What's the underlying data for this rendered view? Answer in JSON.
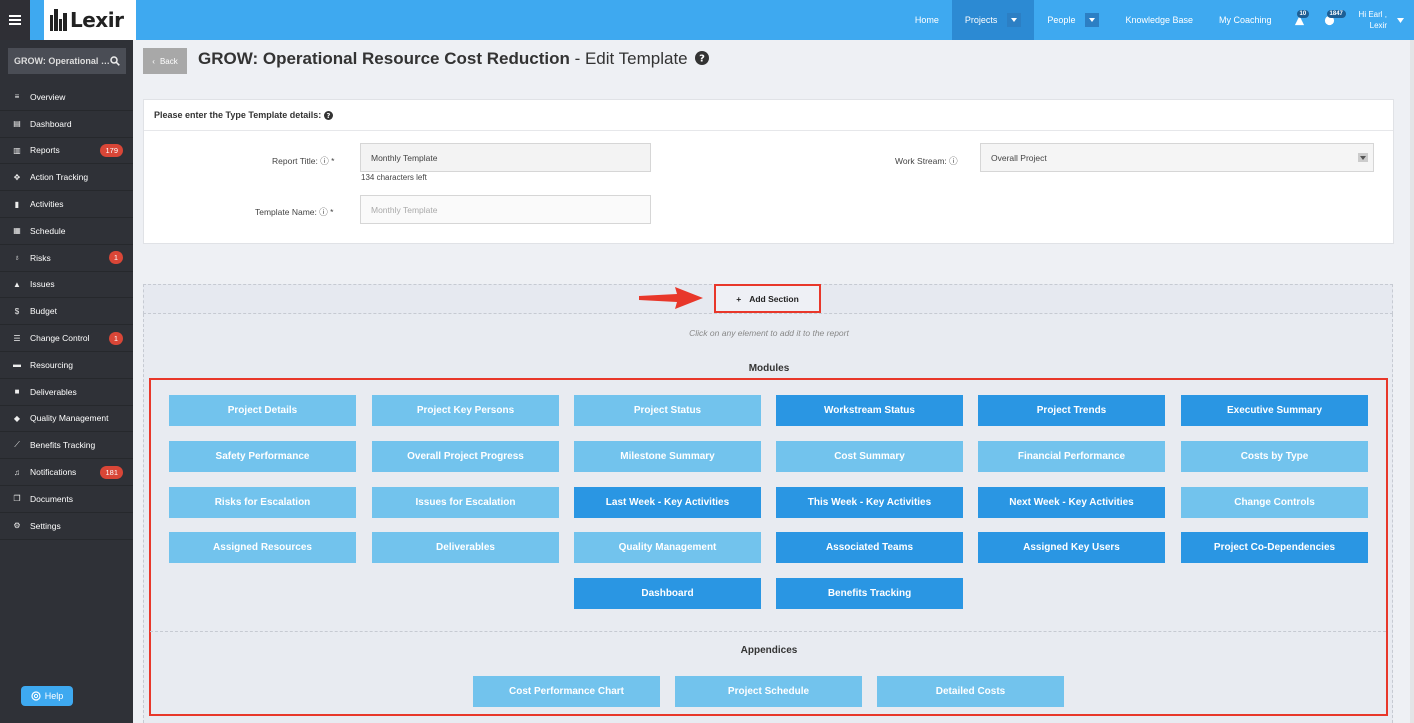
{
  "header": {
    "logo_text": "Lexir",
    "nav": [
      {
        "label": "Home"
      },
      {
        "label": "Projects"
      },
      {
        "label": "People"
      },
      {
        "label": "Knowledge Base"
      },
      {
        "label": "My Coaching"
      }
    ],
    "alerts_count": "10",
    "messages_count": "1847",
    "greeting_line1": "Hi Earl ,",
    "greeting_line2": "Lexir"
  },
  "sidebar": {
    "search_text": "GROW: Operational Resource Cost Reduction",
    "items": [
      {
        "label": "Overview",
        "icon": "list-icon"
      },
      {
        "label": "Dashboard",
        "icon": "dashboard-icon"
      },
      {
        "label": "Reports",
        "icon": "bar-chart-icon",
        "badge": "179"
      },
      {
        "label": "Action Tracking",
        "icon": "crosshair-icon"
      },
      {
        "label": "Activities",
        "icon": "bookmark-icon"
      },
      {
        "label": "Schedule",
        "icon": "calendar-icon"
      },
      {
        "label": "Risks",
        "icon": "lightbulb-icon",
        "badge": "1"
      },
      {
        "label": "Issues",
        "icon": "warning-icon"
      },
      {
        "label": "Budget",
        "icon": "dollar-icon"
      },
      {
        "label": "Change Control",
        "icon": "sliders-icon",
        "badge": "1"
      },
      {
        "label": "Resourcing",
        "icon": "folder-icon"
      },
      {
        "label": "Deliverables",
        "icon": "truck-icon"
      },
      {
        "label": "Quality Management",
        "icon": "tag-icon"
      },
      {
        "label": "Benefits Tracking",
        "icon": "line-chart-icon"
      },
      {
        "label": "Notifications",
        "icon": "bell-icon",
        "badge": "181"
      },
      {
        "label": "Documents",
        "icon": "copy-icon"
      },
      {
        "label": "Settings",
        "icon": "cogs-icon"
      }
    ],
    "help_label": "Help"
  },
  "page": {
    "back_label": "Back",
    "title_bold": "GROW: Operational Resource Cost Reduction",
    "title_rest": " - Edit Template"
  },
  "form": {
    "heading": "Please enter the Type Template details:",
    "report_title_label": "Report Title:",
    "report_title_value": "Monthly Template",
    "chars_left": "134 characters left",
    "template_name_label": "Template Name:",
    "template_name_placeholder": "Monthly Template",
    "work_stream_label": "Work Stream:",
    "work_stream_value": "Overall Project",
    "required_mark": "*"
  },
  "section": {
    "add_section_label": "Add Section",
    "click_hint": "Click on any element to add it to the report",
    "modules_title": "Modules",
    "appendices_title": "Appendices"
  },
  "modules": [
    {
      "label": "Project Details",
      "tone": "light"
    },
    {
      "label": "Project Key Persons",
      "tone": "light"
    },
    {
      "label": "Project Status",
      "tone": "light"
    },
    {
      "label": "Workstream Status",
      "tone": "dark"
    },
    {
      "label": "Project Trends",
      "tone": "dark"
    },
    {
      "label": "Executive Summary",
      "tone": "dark"
    },
    {
      "label": "Safety Performance",
      "tone": "light"
    },
    {
      "label": "Overall Project Progress",
      "tone": "light"
    },
    {
      "label": "Milestone Summary",
      "tone": "light"
    },
    {
      "label": "Cost Summary",
      "tone": "light"
    },
    {
      "label": "Financial Performance",
      "tone": "light"
    },
    {
      "label": "Costs by Type",
      "tone": "light"
    },
    {
      "label": "Risks for Escalation",
      "tone": "light"
    },
    {
      "label": "Issues for Escalation",
      "tone": "light"
    },
    {
      "label": "Last Week - Key Activities",
      "tone": "dark"
    },
    {
      "label": "This Week - Key Activities",
      "tone": "dark"
    },
    {
      "label": "Next Week - Key Activities",
      "tone": "dark"
    },
    {
      "label": "Change Controls",
      "tone": "light"
    },
    {
      "label": "Assigned Resources",
      "tone": "light"
    },
    {
      "label": "Deliverables",
      "tone": "light"
    },
    {
      "label": "Quality Management",
      "tone": "light"
    },
    {
      "label": "Associated Teams",
      "tone": "dark"
    },
    {
      "label": "Assigned Key Users",
      "tone": "dark"
    },
    {
      "label": "Project Co-Dependencies",
      "tone": "dark"
    },
    {
      "label": "Dashboard",
      "tone": "dark"
    },
    {
      "label": "Benefits Tracking",
      "tone": "dark"
    }
  ],
  "appendices": [
    {
      "label": "Cost Performance Chart",
      "tone": "light"
    },
    {
      "label": "Project Schedule",
      "tone": "light"
    },
    {
      "label": "Detailed Costs",
      "tone": "light"
    }
  ]
}
